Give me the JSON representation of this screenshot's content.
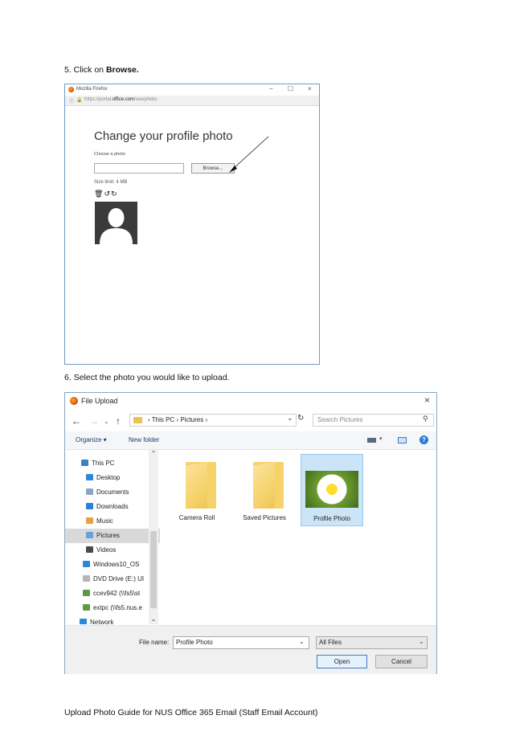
{
  "step5": {
    "prefix": "5. Click on ",
    "bold": "Browse."
  },
  "step6": {
    "text": "6. Select the photo you would like to upload."
  },
  "firefox": {
    "window_title": "Mozilla Firefox",
    "controls": {
      "minimize": "–",
      "maximize": "☐",
      "close": "×"
    },
    "url_prefix": "https://portal.",
    "url_host": "office.com",
    "url_path": "/userphoto",
    "page": {
      "title": "Change your profile photo",
      "choose_label": "Choose a photo",
      "browse_label": "Browse...",
      "size_limit": "Size limit: 4 MB",
      "tools": "🗑↺↻"
    }
  },
  "dialog": {
    "title": "File Upload",
    "close": "×",
    "breadcrumb": [
      "This PC",
      "Pictures"
    ],
    "search_placeholder": "Search Pictures",
    "organize": "Organize ▾",
    "new_folder": "New folder",
    "help": "?",
    "tree": [
      {
        "label": "This PC",
        "icon": "computer-icon",
        "color": "#3e7fc4"
      },
      {
        "label": "Desktop",
        "icon": "desktop-icon",
        "color": "#2e88d8"
      },
      {
        "label": "Documents",
        "icon": "documents-icon",
        "color": "#8ba6c4"
      },
      {
        "label": "Downloads",
        "icon": "downloads-icon",
        "color": "#2f7ed8"
      },
      {
        "label": "Music",
        "icon": "music-icon",
        "color": "#e9a23b"
      },
      {
        "label": "Pictures",
        "icon": "pictures-icon",
        "color": "#6aa0d8",
        "selected": true
      },
      {
        "label": "Videos",
        "icon": "videos-icon",
        "color": "#4a4a4a"
      },
      {
        "label": "Windows10_OS",
        "icon": "drive-icon",
        "color": "#2e88d8"
      },
      {
        "label": "DVD Drive (E:) UI",
        "icon": "dvd-icon",
        "color": "#b5b5b5"
      },
      {
        "label": "ccev942 (\\\\fs5\\st",
        "icon": "network-drive-icon",
        "color": "#5e9a42"
      },
      {
        "label": "extpc (\\\\fs5.nus.e",
        "icon": "network-drive-icon",
        "color": "#5e9a42"
      },
      {
        "label": "Network",
        "icon": "network-icon",
        "color": "#2e88d8"
      }
    ],
    "files": [
      {
        "label": "Camera Roll",
        "kind": "folder"
      },
      {
        "label": "Saved Pictures",
        "kind": "folder"
      },
      {
        "label": "Profile Photo",
        "kind": "photo",
        "selected": true
      }
    ],
    "file_name_label": "File name:",
    "file_name_value": "Profile Photo",
    "file_type": "All Files",
    "open": "Open",
    "cancel": "Cancel"
  },
  "footer": "Upload Photo Guide for NUS Office 365 Email (Staff Email Account)"
}
